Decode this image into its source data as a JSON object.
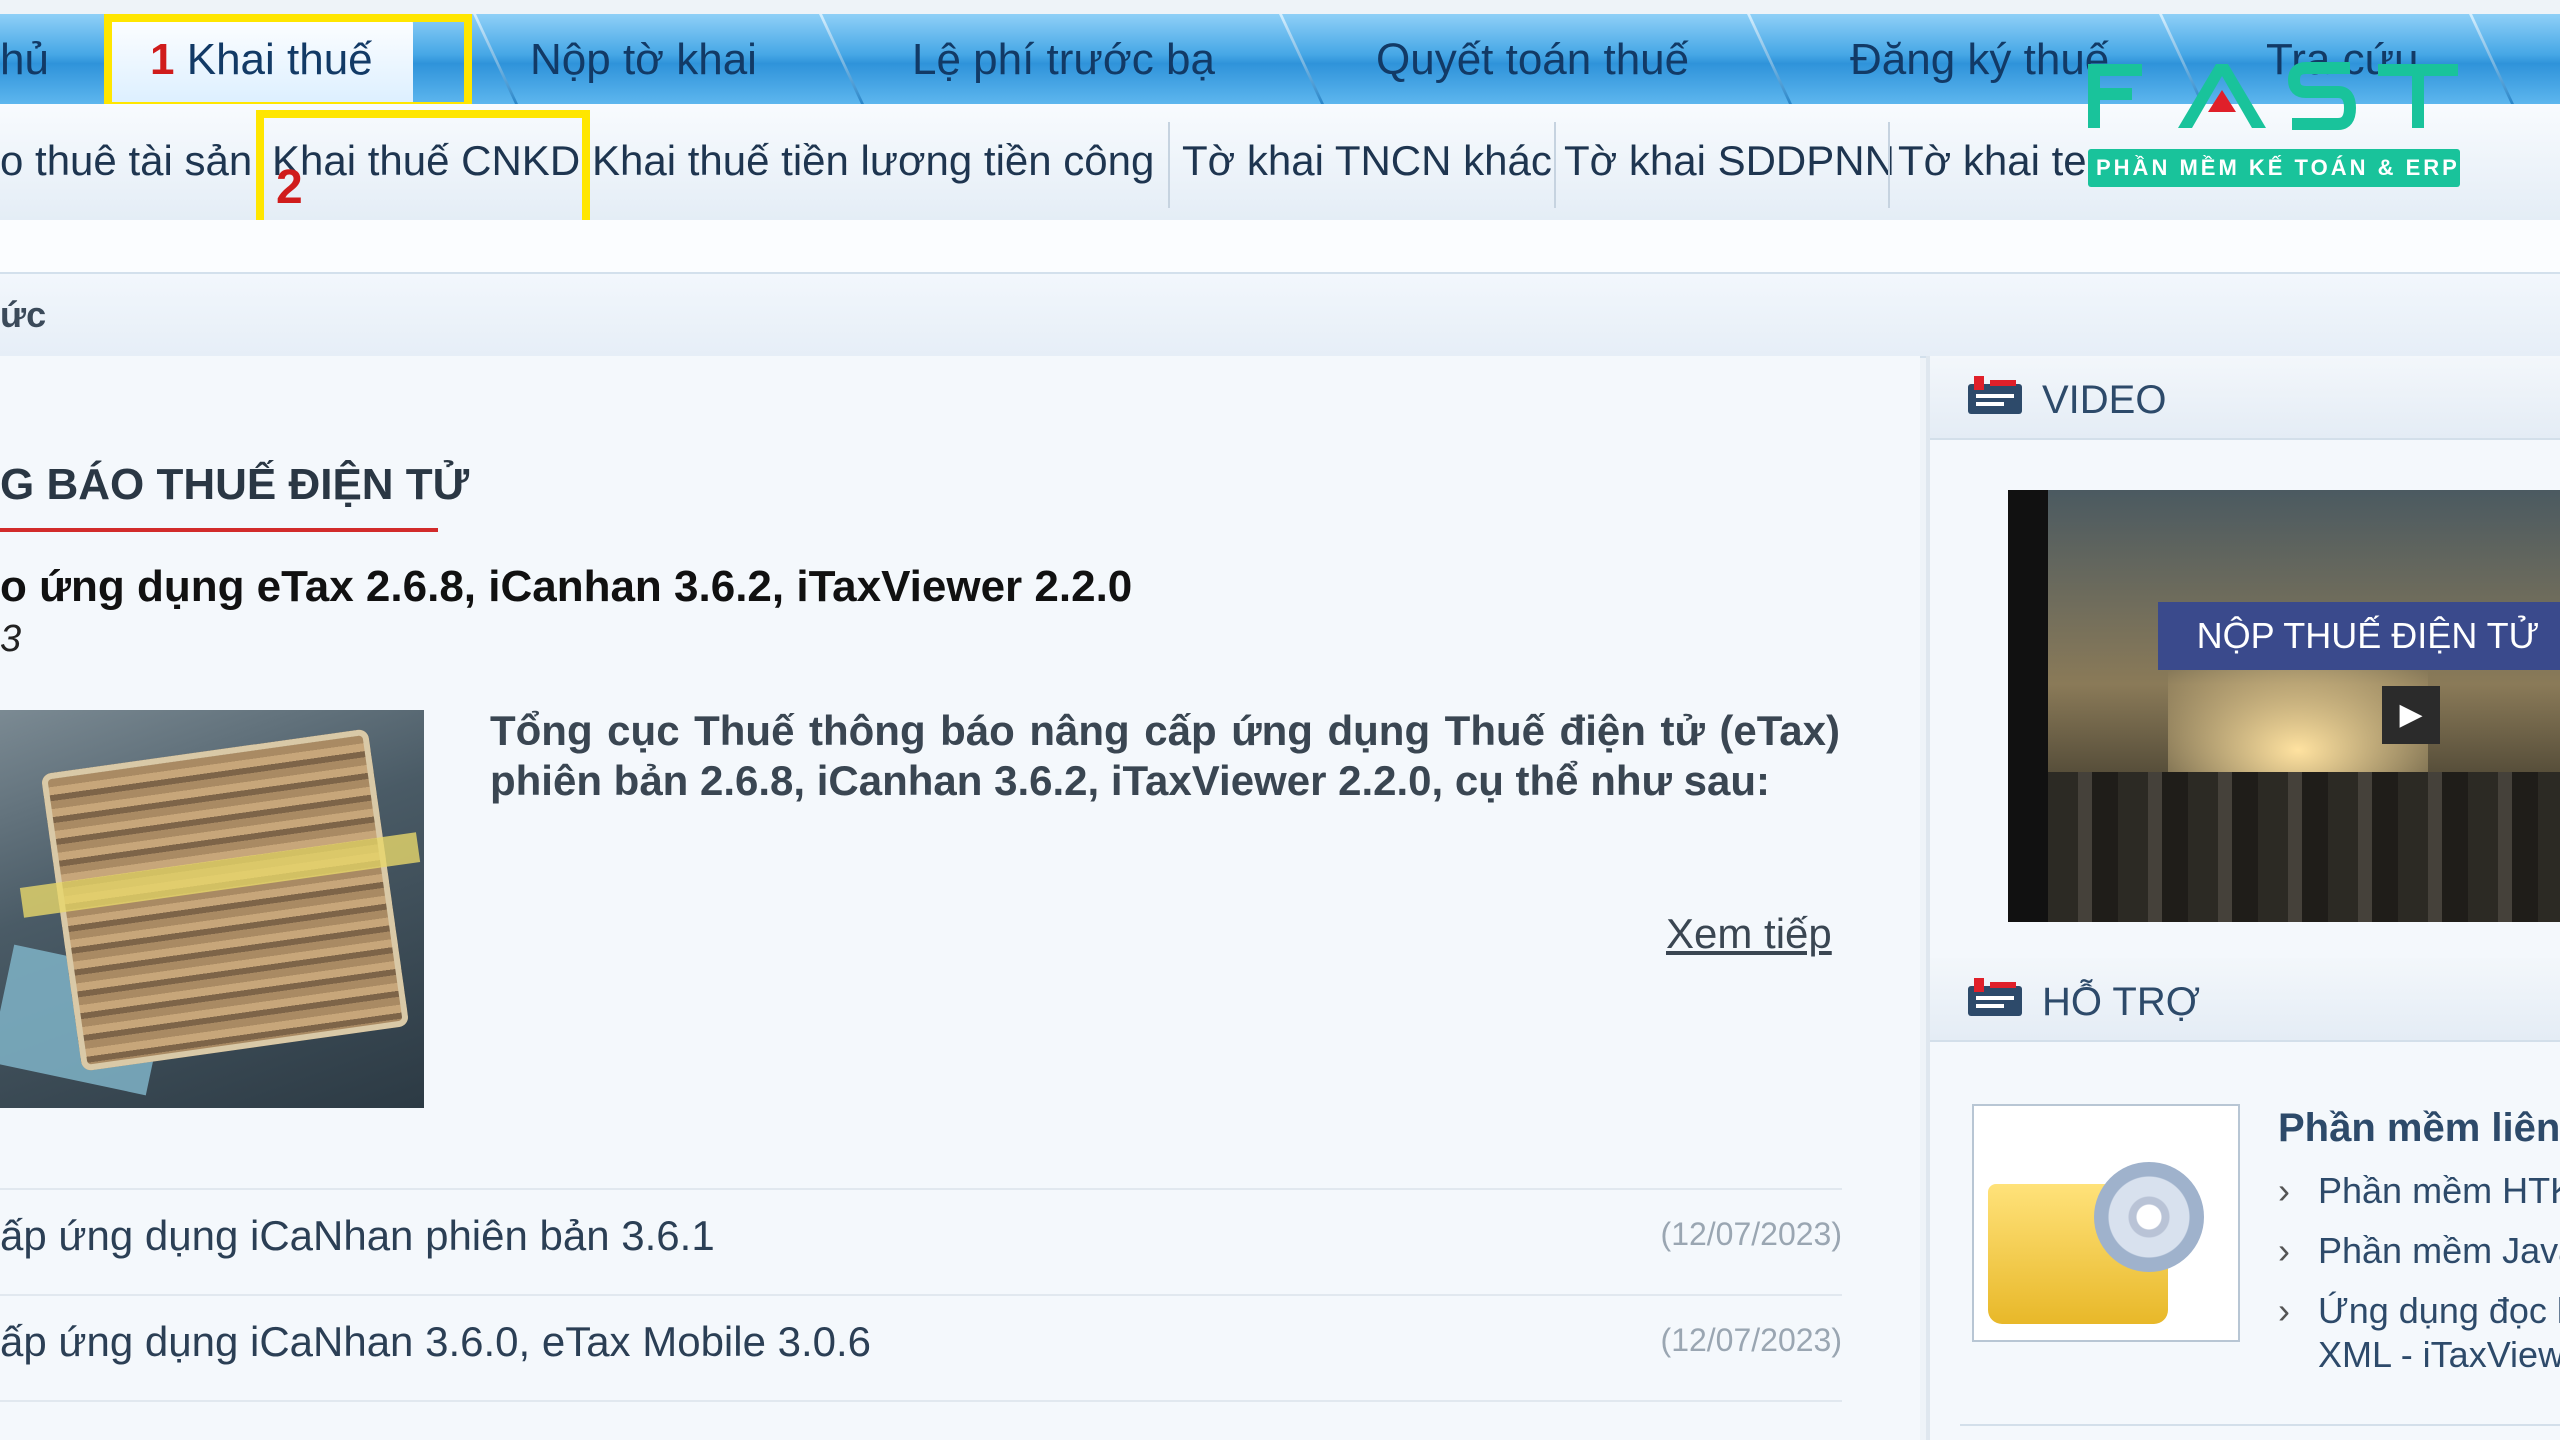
{
  "top_nav": {
    "tabs": [
      {
        "label": "hủ"
      },
      {
        "label": "Khai thuế",
        "marker": "1"
      },
      {
        "label": "Nộp tờ khai"
      },
      {
        "label": "Lệ phí trước bạ"
      },
      {
        "label": "Quyết toán thuế"
      },
      {
        "label": "Đăng ký thuế"
      },
      {
        "label": "Tra cứu"
      }
    ]
  },
  "sub_nav": {
    "items": [
      {
        "label": "o thuê tài sản"
      },
      {
        "label": "Khai thuế CNKD",
        "marker": "2"
      },
      {
        "label": "Khai thuế tiền lương tiền công"
      },
      {
        "label": "Tờ khai TNCN khác"
      },
      {
        "label": "Tờ khai SDDPNN"
      },
      {
        "label": "Tờ khai te"
      }
    ]
  },
  "logo": {
    "word": "FAST",
    "tagline": "PHẦN MỀM KẾ TOÁN & ERP",
    "colors": {
      "green": "#19c39b",
      "red": "#e0202a"
    }
  },
  "breadcrumb": {
    "text": "ức"
  },
  "main": {
    "section_title": "G BÁO THUẾ ĐIỆN TỬ",
    "featured": {
      "title": "o ứng dụng eTax 2.6.8, iCanhan 3.6.2, iTaxViewer 2.2.0",
      "date": "3",
      "summary": "Tổng cục Thuế thông báo nâng cấp ứng dụng Thuế điện tử (eTax) phiên bản 2.6.8, iCanhan 3.6.2, iTaxViewer 2.2.0, cụ thể như sau:",
      "more_link": "Xem tiếp"
    },
    "list": [
      {
        "title": "ấp ứng dụng iCaNhan phiên bản 3.6.1",
        "date": "(12/07/2023)"
      },
      {
        "title": "ấp ứng dụng iCaNhan 3.6.0, eTax Mobile 3.0.6",
        "date": "(12/07/2023)"
      }
    ]
  },
  "sidebar": {
    "video": {
      "heading": "VIDEO",
      "banner": "NỘP THUẾ ĐIỆN TỬ",
      "play_icon": "play-icon"
    },
    "support": {
      "heading": "HỖ TRỢ",
      "title": "Phần mềm liên",
      "items": [
        {
          "label": "Phần mềm HTK"
        },
        {
          "label": "Phần mềm Java"
        },
        {
          "label": "Ứng dụng đọc l"
        },
        {
          "label": "XML - iTaxView"
        }
      ]
    }
  },
  "colors": {
    "highlight": "#ffe600",
    "marker": "#d01c1c",
    "nav_blue": "#2f93da"
  }
}
